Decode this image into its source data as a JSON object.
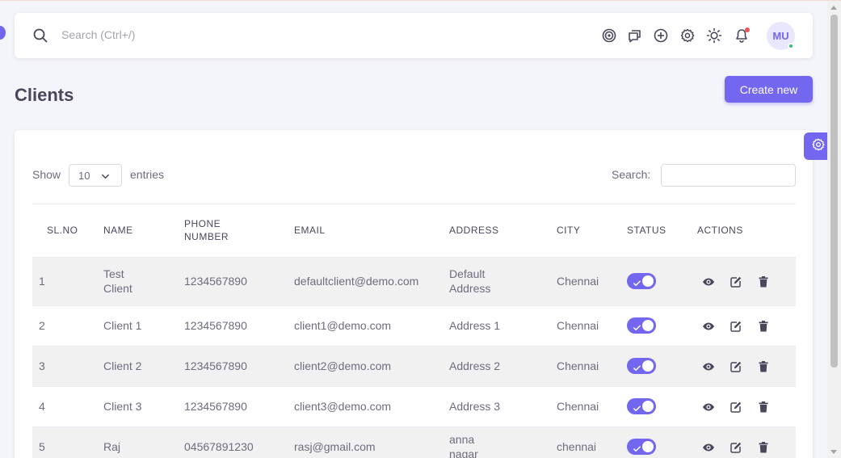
{
  "header": {
    "search_placeholder": "Search (Ctrl+/)",
    "icons": [
      "target-icon",
      "chat-icon",
      "add-circle-icon",
      "settings-icon",
      "theme-sun-icon",
      "bell-icon"
    ],
    "avatar_initials": "MU"
  },
  "page": {
    "title": "Clients",
    "create_button": "Create new"
  },
  "table_controls": {
    "show_label": "Show",
    "entries_value": "10",
    "entries_label": "entries",
    "search_label": "Search:"
  },
  "table": {
    "columns": [
      "SL.NO",
      "NAME",
      "PHONE NUMBER",
      "EMAIL",
      "ADDRESS",
      "CITY",
      "STATUS",
      "ACTIONS"
    ],
    "rows": [
      {
        "sl": "1",
        "name": "Test Client",
        "phone": "1234567890",
        "email": "defaultclient@demo.com",
        "address": "Default Address",
        "city": "Chennai",
        "status": "on"
      },
      {
        "sl": "2",
        "name": "Client 1",
        "phone": "1234567890",
        "email": "client1@demo.com",
        "address": "Address 1",
        "city": "Chennai",
        "status": "on"
      },
      {
        "sl": "3",
        "name": "Client 2",
        "phone": "1234567890",
        "email": "client2@demo.com",
        "address": "Address 2",
        "city": "Chennai",
        "status": "on"
      },
      {
        "sl": "4",
        "name": "Client 3",
        "phone": "1234567890",
        "email": "client3@demo.com",
        "address": "Address 3",
        "city": "Chennai",
        "status": "on"
      },
      {
        "sl": "5",
        "name": "Raj",
        "phone": "04567891230",
        "email": "rasj@gmail.com",
        "address": "anna nagar",
        "city": "chennai",
        "status": "on"
      }
    ]
  },
  "colors": {
    "primary": "#7367f0",
    "online": "#28c76f",
    "notification": "#ea5455"
  }
}
